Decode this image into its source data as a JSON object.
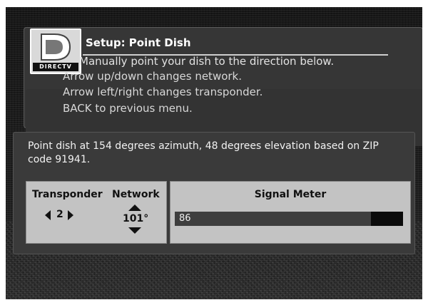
{
  "header": {
    "title": "Setup: Point Dish",
    "logo_text": "DIRECTV",
    "instructions": [
      "Manually point your dish to the direction below.",
      "Arrow up/down changes network.",
      "Arrow left/right changes transponder.",
      "BACK to previous menu."
    ]
  },
  "main": {
    "info_text": "Point dish at 154 degrees azimuth, 48 degrees elevation based on ZIP code 91941.",
    "transponder": {
      "label": "Transponder",
      "value": "2"
    },
    "network": {
      "label": "Network",
      "value": "101°"
    },
    "signal_meter": {
      "label": "Signal Meter",
      "value": "86",
      "fill_fraction": 0.86
    }
  },
  "colors": {
    "background": "#1b1b1b",
    "panel": "#3a3a3a",
    "box": "#c3c3c3",
    "meter_bg": "#0b0b0b"
  }
}
